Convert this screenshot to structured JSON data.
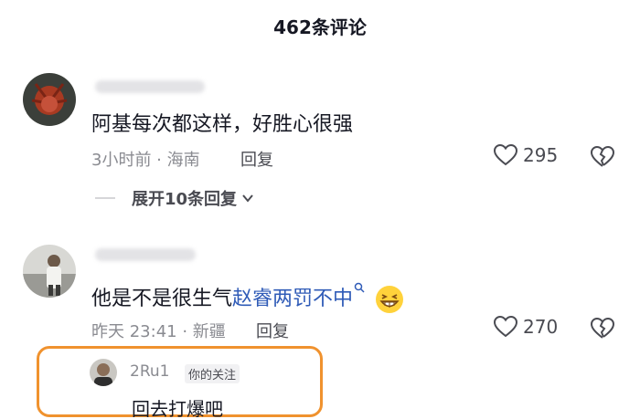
{
  "header": {
    "title": "462条评论"
  },
  "comments": [
    {
      "text": "阿基每次都这样，好胜心很强",
      "meta": "3小时前 · 海南",
      "reply_label": "回复",
      "likes": "295",
      "expand_label": "展开10条回复"
    },
    {
      "text_before": "他是不是很生气",
      "text_link": "赵睿两罚不中",
      "meta": "昨天 23:41 · 新疆",
      "reply_label": "回复",
      "likes": "270",
      "reply": {
        "username": "2Ru1",
        "tag": "你的关注",
        "text": "回去打爆吧"
      }
    }
  ],
  "colors": {
    "highlight_border": "#f0922e",
    "link": "#2f5bb7"
  }
}
